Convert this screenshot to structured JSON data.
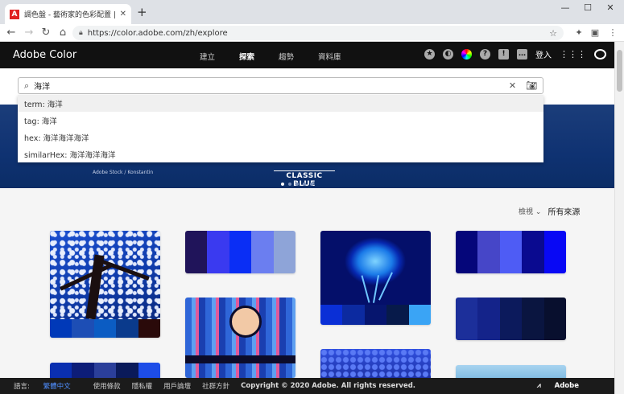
{
  "browser": {
    "tab_title": "調色盤 - 藝術家的色彩配置 | Adobe Color",
    "tab_favicon": "A",
    "url": "https://color.adobe.com/zh/explore"
  },
  "header": {
    "brand": "Adobe Color",
    "nav": [
      "建立",
      "探索",
      "趨勢",
      "資料庫"
    ],
    "signin": "登入"
  },
  "search": {
    "query": "海洋",
    "suggestions": [
      "term: 海洋",
      "tag: 海洋",
      "hex: 海洋海洋海洋",
      "similarHex: 海洋海洋海洋"
    ]
  },
  "hero": {
    "credit": "Adobe Stock / Konstantin",
    "label": "CLASSIC BLUE"
  },
  "filter": {
    "sort": "檢視",
    "source": "所有來源"
  },
  "colors": {
    "accent": "#1473e6",
    "header_bg": "#111111",
    "footer_bg": "#1b1b1b"
  },
  "footer": {
    "lang_label": "語言:",
    "lang_value": "繁體中文",
    "links": [
      "使用條款",
      "隱私權",
      "用戶論壇",
      "社群方針"
    ],
    "copyright": "Copyright © 2020 Adobe. All rights reserved.",
    "adobe": "Adobe"
  },
  "palettes": {
    "p1": [
      "#0039b8",
      "#1d4eb5",
      "#0b5cc3",
      "#0a3a8c",
      "#2a0a0a"
    ],
    "p2": [
      "#20145a",
      "#3a3af0",
      "#0a2ef5",
      "#6b7ef0",
      "#8ea4d8"
    ],
    "p3": [
      "#0a2fd6",
      "#0c2aa0",
      "#06156e",
      "#071a4a",
      "#3aa4f5"
    ],
    "p4": [
      "#05067a",
      "#4646c8",
      "#4e5cf5",
      "#0a0a90",
      "#0808f5"
    ],
    "p5": [
      "#1c2f9a",
      "#14238a",
      "#0c1a5c",
      "#0a1540",
      "#080f2e"
    ]
  }
}
